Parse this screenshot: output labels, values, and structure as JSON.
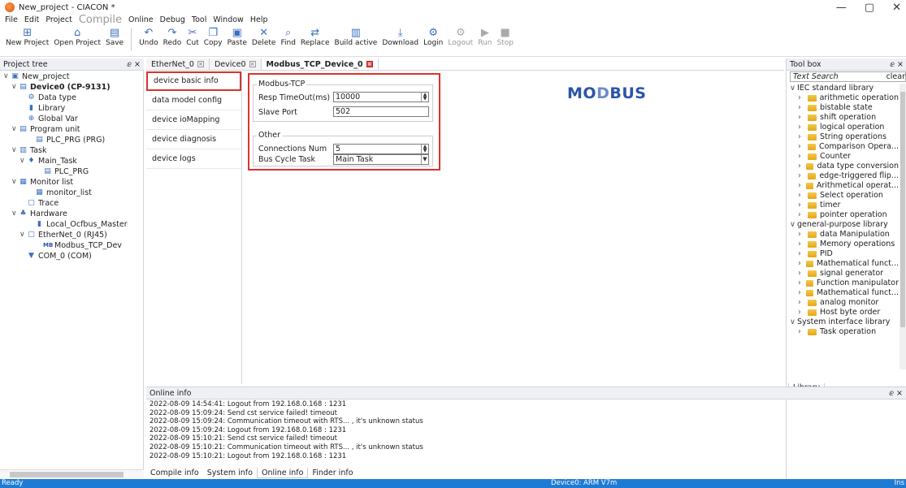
{
  "window": {
    "title": "New_project - CIACON *",
    "min": "—",
    "max": "▢",
    "close": "✕"
  },
  "menu": [
    "File",
    "Edit",
    "Project",
    "Compile",
    "Online",
    "Debug",
    "Tool",
    "Window",
    "Help"
  ],
  "toolbar": [
    {
      "label": "New Project",
      "icon": "new-project-icon",
      "glyph": "⊞",
      "enabled": true
    },
    {
      "label": "Open Project",
      "icon": "open-project-icon",
      "glyph": "⌂",
      "enabled": true
    },
    {
      "label": "Save",
      "icon": "save-icon",
      "glyph": "▤",
      "enabled": true
    },
    {
      "sep": true
    },
    {
      "label": "Undo",
      "icon": "undo-icon",
      "glyph": "↶",
      "enabled": true
    },
    {
      "label": "Redo",
      "icon": "redo-icon",
      "glyph": "↷",
      "enabled": true
    },
    {
      "label": "Cut",
      "icon": "cut-icon",
      "glyph": "✂",
      "enabled": true
    },
    {
      "label": "Copy",
      "icon": "copy-icon",
      "glyph": "❐",
      "enabled": true
    },
    {
      "label": "Paste",
      "icon": "paste-icon",
      "glyph": "▣",
      "enabled": true
    },
    {
      "label": "Delete",
      "icon": "delete-icon",
      "glyph": "✕",
      "enabled": true
    },
    {
      "label": "Find",
      "icon": "find-icon",
      "glyph": "⌕",
      "enabled": true
    },
    {
      "label": "Replace",
      "icon": "replace-icon",
      "glyph": "⇄",
      "enabled": true
    },
    {
      "label": "Build active",
      "icon": "build-icon",
      "glyph": "▥",
      "enabled": true
    },
    {
      "label": "Download",
      "icon": "download-icon",
      "glyph": "⤓",
      "enabled": true
    },
    {
      "label": "Login",
      "icon": "login-icon",
      "glyph": "⚙",
      "enabled": true
    },
    {
      "label": "Logout",
      "icon": "logout-icon",
      "glyph": "⚙",
      "enabled": false
    },
    {
      "label": "Run",
      "icon": "run-icon",
      "glyph": "▶",
      "enabled": false
    },
    {
      "label": "Stop",
      "icon": "stop-icon",
      "glyph": "■",
      "enabled": false
    }
  ],
  "project_tree": {
    "title": "Project tree",
    "pin": "ⅇ ×",
    "items": [
      {
        "label": "New_project",
        "indent": 0,
        "chev": "∨",
        "icon": "project-icon",
        "glyph": "▣",
        "bold": false
      },
      {
        "label": "Device0 (CP-9131)",
        "indent": 1,
        "chev": "∨",
        "icon": "device-icon",
        "glyph": "▤",
        "bold": true
      },
      {
        "label": "Data type",
        "indent": 2,
        "chev": "",
        "icon": "data-type-icon",
        "glyph": "⚙",
        "bold": false
      },
      {
        "label": "Library",
        "indent": 2,
        "chev": "",
        "icon": "library-icon",
        "glyph": "▮",
        "bold": false
      },
      {
        "label": "Global Var",
        "indent": 2,
        "chev": "",
        "icon": "global-var-icon",
        "glyph": "⊕",
        "bold": false
      },
      {
        "label": "Program unit",
        "indent": 1,
        "chev": "∨",
        "icon": "program-unit-icon",
        "glyph": "▤",
        "bold": false
      },
      {
        "label": "PLC_PRG (PRG)",
        "indent": 3,
        "chev": "",
        "icon": "prg-icon",
        "glyph": "▤",
        "bold": false
      },
      {
        "label": "Task",
        "indent": 1,
        "chev": "∨",
        "icon": "task-icon",
        "glyph": "▥",
        "bold": false
      },
      {
        "label": "Main_Task",
        "indent": 2,
        "chev": "∨",
        "icon": "main-task-icon",
        "glyph": "♦",
        "bold": false
      },
      {
        "label": "PLC_PRG",
        "indent": 4,
        "chev": "",
        "icon": "prg-ref-icon",
        "glyph": "▤",
        "bold": false
      },
      {
        "label": "Monitor list",
        "indent": 1,
        "chev": "∨",
        "icon": "monitor-list-icon",
        "glyph": "▦",
        "bold": false
      },
      {
        "label": "monitor_list",
        "indent": 3,
        "chev": "",
        "icon": "monitor-item-icon",
        "glyph": "▦",
        "bold": false
      },
      {
        "label": "Trace",
        "indent": 2,
        "chev": "",
        "icon": "trace-icon",
        "glyph": "▢",
        "bold": false
      },
      {
        "label": "Hardware",
        "indent": 1,
        "chev": "∨",
        "icon": "hardware-icon",
        "glyph": "♣",
        "bold": false
      },
      {
        "label": "Local_Ocfbus_Master",
        "indent": 3,
        "chev": "",
        "icon": "ocfbus-icon",
        "glyph": "▮",
        "bold": false
      },
      {
        "label": "EtherNet_0 (RJ45)",
        "indent": 2,
        "chev": "∨",
        "icon": "ethernet-icon",
        "glyph": "▢",
        "bold": false
      },
      {
        "label": "Modbus_TCP_Dev",
        "indent": 4,
        "chev": "",
        "icon": "modbus-device-icon",
        "glyph": "MB",
        "bold": false
      },
      {
        "label": "COM_0 (COM)",
        "indent": 2,
        "chev": "",
        "icon": "com-icon",
        "glyph": "▼",
        "bold": false
      }
    ]
  },
  "tabs": [
    {
      "label": "EtherNet_0",
      "active": false
    },
    {
      "label": "Device0",
      "active": false
    },
    {
      "label": "Modbus_TCP_Device_0",
      "active": true
    }
  ],
  "device_nav": [
    {
      "label": "device basic info",
      "selected": true
    },
    {
      "label": "data model config",
      "selected": false
    },
    {
      "label": "device ioMapping",
      "selected": false
    },
    {
      "label": "device diagnosis",
      "selected": false
    },
    {
      "label": "device logs",
      "selected": false
    }
  ],
  "config": {
    "modbus_group": "Modbus-TCP",
    "resp_label": "Resp TimeOut(ms)",
    "resp_value": "10000",
    "slave_label": "Slave Port",
    "slave_value": "502",
    "other_group": "Other",
    "conn_label": "Connections Num",
    "conn_value": "5",
    "bus_label": "Bus Cycle Task",
    "bus_value": "Main Task"
  },
  "logo": {
    "a": "MO",
    "b": "D",
    "c": "BUS"
  },
  "toolbox": {
    "title": "Tool box",
    "pin": "ⅇ ×",
    "search": "Text Search",
    "clear": "clear",
    "library_tab": "Library",
    "items": [
      {
        "label": "IEC standard library",
        "level": 0,
        "chev": "∨"
      },
      {
        "label": "arithmetic operation",
        "level": 1,
        "chev": "›"
      },
      {
        "label": "bistable state",
        "level": 1,
        "chev": "›"
      },
      {
        "label": "shift operation",
        "level": 1,
        "chev": "›"
      },
      {
        "label": "logical operation",
        "level": 1,
        "chev": "›"
      },
      {
        "label": "String operations",
        "level": 1,
        "chev": "›"
      },
      {
        "label": "Comparison Opera...",
        "level": 1,
        "chev": "›"
      },
      {
        "label": "Counter",
        "level": 1,
        "chev": "›"
      },
      {
        "label": "data type conversion",
        "level": 1,
        "chev": "›"
      },
      {
        "label": "edge-triggered flip...",
        "level": 1,
        "chev": "›"
      },
      {
        "label": "Arithmetical operat...",
        "level": 1,
        "chev": "›"
      },
      {
        "label": "Select operation",
        "level": 1,
        "chev": "›"
      },
      {
        "label": "timer",
        "level": 1,
        "chev": "›"
      },
      {
        "label": "pointer operation",
        "level": 1,
        "chev": "›"
      },
      {
        "label": "general-purpose library",
        "level": 0,
        "chev": "∨"
      },
      {
        "label": "data Manipulation",
        "level": 1,
        "chev": "›"
      },
      {
        "label": "Memory operations",
        "level": 1,
        "chev": "›"
      },
      {
        "label": "PID",
        "level": 1,
        "chev": "›"
      },
      {
        "label": "Mathematical funct...",
        "level": 1,
        "chev": "›"
      },
      {
        "label": "signal generator",
        "level": 1,
        "chev": "›"
      },
      {
        "label": "Function manipulator",
        "level": 1,
        "chev": "›"
      },
      {
        "label": "Mathematical funct...",
        "level": 1,
        "chev": "›"
      },
      {
        "label": "analog monitor",
        "level": 1,
        "chev": "›"
      },
      {
        "label": "Host byte order",
        "level": 1,
        "chev": "›"
      },
      {
        "label": "System interface library",
        "level": 0,
        "chev": "∨"
      },
      {
        "label": "Task operation",
        "level": 1,
        "chev": "›"
      }
    ]
  },
  "online_info": {
    "title": "Online info",
    "pin": "ⅇ ×",
    "lines": [
      "2022-08-09 14:54:41: Logout from 192.168.0.168 : 1231",
      "2022-08-09 15:09:24: Send cst service failed!  timeout",
      "2022-08-09 15:09:24: Communication timeout with RTS... , it's unknown status",
      "2022-08-09 15:09:24: Logout from 192.168.0.168 : 1231",
      "2022-08-09 15:10:21: Send cst service failed!  timeout",
      "2022-08-09 15:10:21: Communication timeout with RTS... , it's unknown status",
      "2022-08-09 15:10:21: Logout from 192.168.0.168 : 1231"
    ]
  },
  "bottom_tabs": [
    {
      "label": "Compile info",
      "active": false
    },
    {
      "label": "System info",
      "active": false
    },
    {
      "label": "Online info",
      "active": true
    },
    {
      "label": "Finder info",
      "active": false
    }
  ],
  "status": {
    "left": "Ready",
    "center": "Device0: ARM V7m",
    "right": "Ins"
  }
}
